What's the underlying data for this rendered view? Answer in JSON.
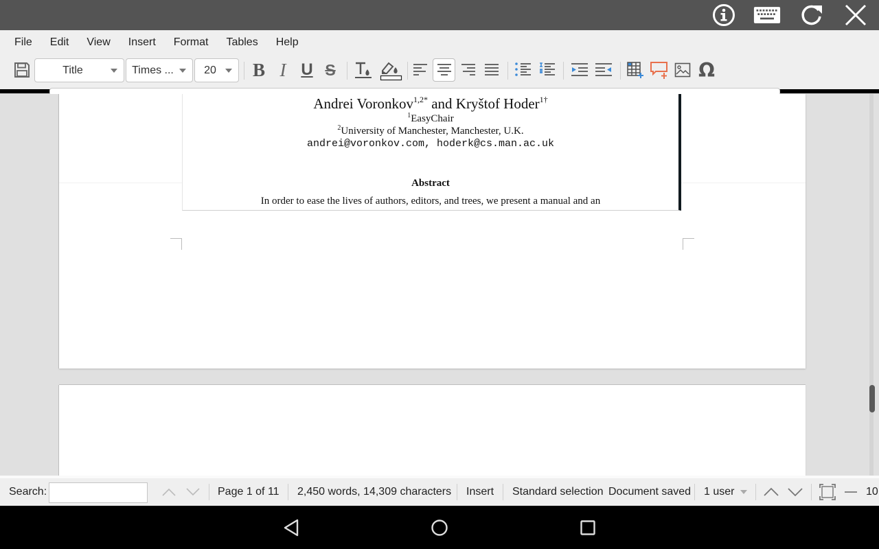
{
  "topbar": {
    "icons": [
      "info-icon",
      "keyboard-icon",
      "refresh-icon",
      "close-icon"
    ]
  },
  "menubar": {
    "items": [
      "File",
      "Edit",
      "View",
      "Insert",
      "Format",
      "Tables",
      "Help"
    ]
  },
  "toolbar": {
    "paragraph_style": "Title",
    "font_name": "Times ...",
    "font_size": "20",
    "buttons": [
      "save",
      "bold",
      "italic",
      "underline",
      "strikethrough",
      "text-color",
      "highlight-color",
      "align-left",
      "align-center",
      "align-right",
      "justify",
      "bulleted-list",
      "numbered-list",
      "decrease-indent",
      "increase-indent",
      "insert-table",
      "insert-comment",
      "insert-image",
      "special-character"
    ],
    "active_alignment": "align-center",
    "colors": {
      "accent_blue": "#3b8ad8",
      "comment_orange": "#e8704c"
    }
  },
  "document": {
    "authors_part1": "Andrei Voronkov",
    "authors_sup1": "1,2*",
    "authors_part2": " and Kryštof Hoder",
    "authors_sup2": "1†",
    "affiliation1_num": "1",
    "affiliation1": "EasyChair",
    "affiliation2_num": "2",
    "affiliation2": "University of Manchester, Manchester, U.K.",
    "emails": "andrei@voronkov.com, hoderk@cs.man.ac.uk",
    "abstract_title": "Abstract",
    "abstract_text": "In order to ease the lives of authors, editors, and trees, we present a manual and an"
  },
  "statusbar": {
    "search_label": "Search:",
    "search_value": "",
    "page_info": "Page 1 of 11",
    "word_count": "2,450 words, 14,309 characters",
    "insert_mode": "Insert",
    "selection_mode": "Standard selection",
    "save_status": "Document saved",
    "users": "1 user",
    "zoom": "10"
  },
  "navbar": {
    "icons": [
      "back-icon",
      "home-icon",
      "recents-icon"
    ]
  }
}
